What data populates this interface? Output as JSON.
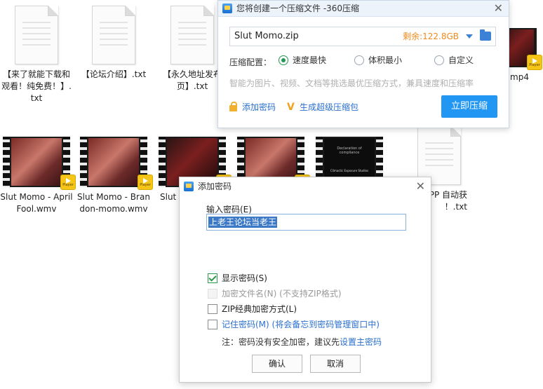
{
  "desktop": {
    "row1": [
      {
        "label": "【来了就能下载和观看！纯免费！】.txt"
      },
      {
        "label": "【论坛介绍】.txt"
      },
      {
        "label": "【永久地址发布页】.txt"
      },
      {
        "label": "ng .mp4"
      }
    ],
    "row2": [
      {
        "label": "Slut Momo - April Fool.wmv"
      },
      {
        "label": "Slut Momo - Brandon-momo.wmv"
      },
      {
        "label": "Slut Susa"
      },
      {
        "label": ""
      },
      {
        "label": ""
      },
      {
        "label": "及APP 自动获 ！.txt"
      }
    ],
    "player_badge": "Player",
    "thumb_text_1": "Declaration of compliance",
    "thumb_text_2": "Climactic Exposure Studios"
  },
  "compress": {
    "title": "您将创建一个压缩文件 -360压缩",
    "filename": "Slut Momo.zip",
    "space": "剩余:122.8GB",
    "config_label": "压缩配置：",
    "options": [
      "速度最快",
      "体积最小",
      "自定义"
    ],
    "selected": "速度最快",
    "hint": "智能为图片、视频、文档等挑选最优压缩方式，兼具速度和压缩率",
    "add_password": "添加密码",
    "super_package": "生成超级压缩包",
    "compress_now": "立即压缩"
  },
  "password_dialog": {
    "title": "添加密码",
    "input_label": "输入密码(E)",
    "password_value": "上老王论坛当老王",
    "show_password": "显示密码(S)",
    "encrypt_names": "加密文件名(N)  (不支持ZIP格式)",
    "zip_classic": "ZIP经典加密方式(L)",
    "remember": "记住密码(M) (将会备忘到密码管理窗口中)",
    "note_prefix": "注：密码没有安全加密，建议先",
    "note_link": "设置主密码",
    "ok": "确认",
    "cancel": "取消"
  }
}
